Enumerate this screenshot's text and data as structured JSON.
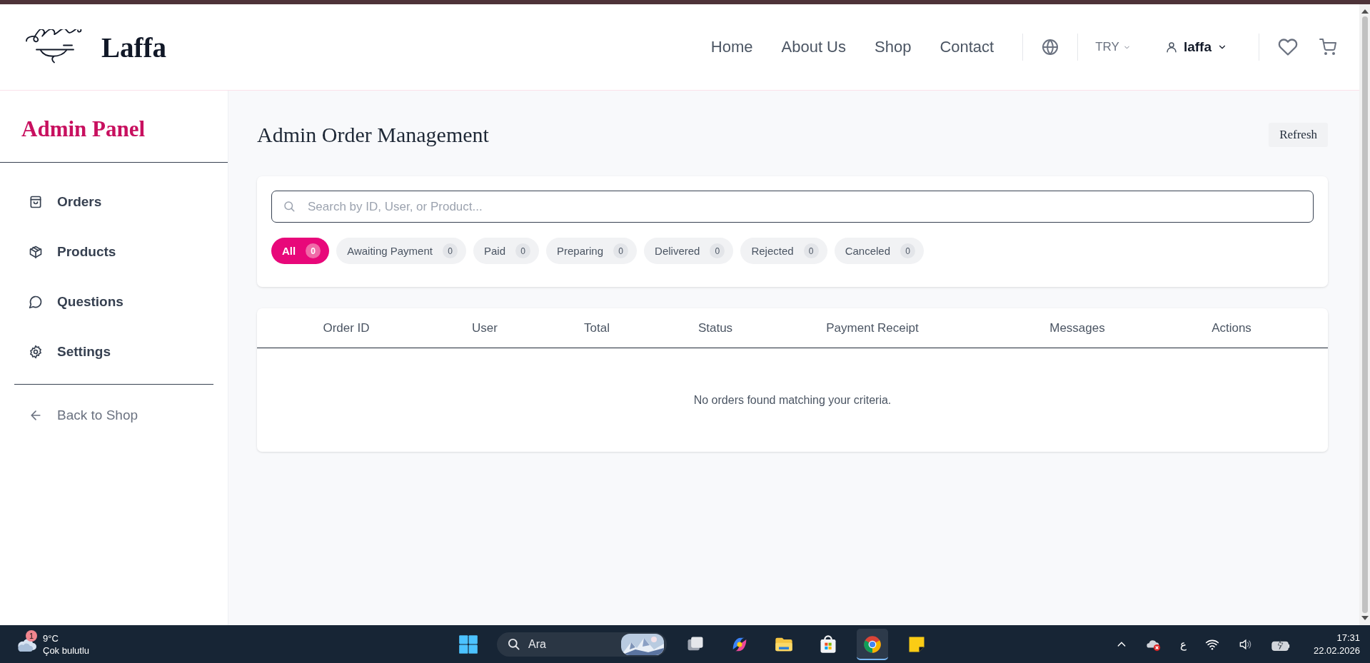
{
  "header": {
    "brand": "Laffa",
    "nav": [
      {
        "label": "Home"
      },
      {
        "label": "About Us"
      },
      {
        "label": "Shop"
      },
      {
        "label": "Contact"
      }
    ],
    "currency": "TRY",
    "user": "laffa"
  },
  "sidebar": {
    "title": "Admin Panel",
    "items": [
      {
        "label": "Orders",
        "selected": false
      },
      {
        "label": "Products",
        "selected": false
      },
      {
        "label": "Questions",
        "selected": false
      },
      {
        "label": "Settings",
        "selected": false
      }
    ],
    "back_link": "Back to Shop"
  },
  "main": {
    "title": "Admin Order Management",
    "refresh_button": "Refresh",
    "search": {
      "placeholder": "Search by ID, User, or Product..."
    },
    "filters": [
      {
        "label": "All",
        "count": "0",
        "selected": true
      },
      {
        "label": "Awaiting Payment",
        "count": "0",
        "selected": false
      },
      {
        "label": "Paid",
        "count": "0",
        "selected": false
      },
      {
        "label": "Preparing",
        "count": "0",
        "selected": false
      },
      {
        "label": "Delivered",
        "count": "0",
        "selected": false
      },
      {
        "label": "Rejected",
        "count": "0",
        "selected": false
      },
      {
        "label": "Canceled",
        "count": "0",
        "selected": false
      }
    ],
    "table": {
      "columns": [
        "Order ID",
        "User",
        "Total",
        "Status",
        "Payment Receipt",
        "Messages",
        "Actions"
      ],
      "empty_message": "No orders found matching your criteria."
    }
  },
  "taskbar": {
    "weather": {
      "badge": "1",
      "temperature": "9°C",
      "condition": "Çok bulutlu"
    },
    "search": {
      "placeholder": "Ara"
    },
    "apps": [
      {
        "kind": "taskview",
        "active": false
      },
      {
        "kind": "copilot",
        "active": false
      },
      {
        "kind": "files",
        "active": false
      },
      {
        "kind": "store",
        "active": false
      },
      {
        "kind": "browser",
        "active": true
      },
      {
        "kind": "notes",
        "active": false
      }
    ],
    "language": "ع",
    "time": "17:31",
    "date": "22.02.2026"
  }
}
